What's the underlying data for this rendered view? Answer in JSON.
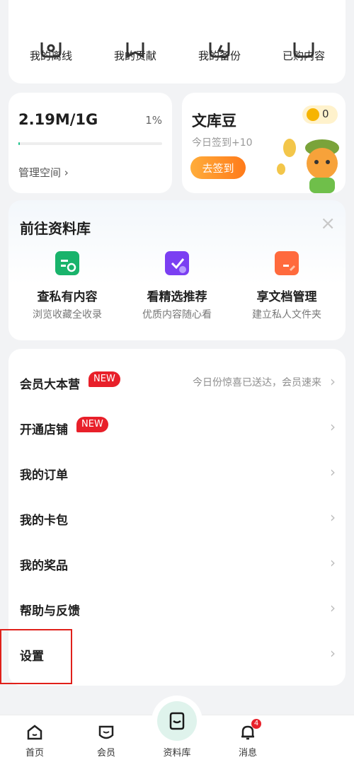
{
  "quick": [
    {
      "label": "我的离线",
      "icon": "offline-icon"
    },
    {
      "label": "我的贡献",
      "icon": "contribution-icon"
    },
    {
      "label": "我的备份",
      "icon": "backup-icon"
    },
    {
      "label": "已购内容",
      "icon": "purchased-icon"
    }
  ],
  "storage": {
    "value": "2.19M/1G",
    "percent": "1%",
    "fill": 0.01,
    "link": "管理空间 ›"
  },
  "beans": {
    "title": "文库豆",
    "count": "0",
    "sub": "今日签到+10",
    "button": "去签到"
  },
  "library": {
    "title": "前往资料库",
    "close": "×",
    "items": [
      {
        "name": "查私有内容",
        "desc": "浏览收藏全收录",
        "color": "#19b36b"
      },
      {
        "name": "看精选推荐",
        "desc": "优质内容随心看",
        "color": "#7b3ff2"
      },
      {
        "name": "享文档管理",
        "desc": "建立私人文件夹",
        "color": "#ff6a3d"
      }
    ]
  },
  "menu": [
    {
      "label": "会员大本营",
      "badge": "NEW",
      "hint": "今日份惊喜已送达，会员速来"
    },
    {
      "label": "开通店铺",
      "badge": "NEW"
    },
    {
      "label": "我的订单"
    },
    {
      "label": "我的卡包"
    },
    {
      "label": "我的奖品"
    },
    {
      "label": "帮助与反馈"
    },
    {
      "label": "设置"
    }
  ],
  "chevron": "›",
  "tabs": [
    {
      "label": "首页",
      "icon": "home-icon"
    },
    {
      "label": "会员",
      "icon": "vip-icon"
    },
    {
      "label": "资料库",
      "icon": "library-icon"
    },
    {
      "label": "消息",
      "icon": "bell-icon",
      "badge": "4"
    }
  ],
  "colors": {
    "accent": "#19c28a",
    "new_badge": "#e8202a",
    "highlight": "#e0201a",
    "checkin": "#ff7a1a"
  }
}
